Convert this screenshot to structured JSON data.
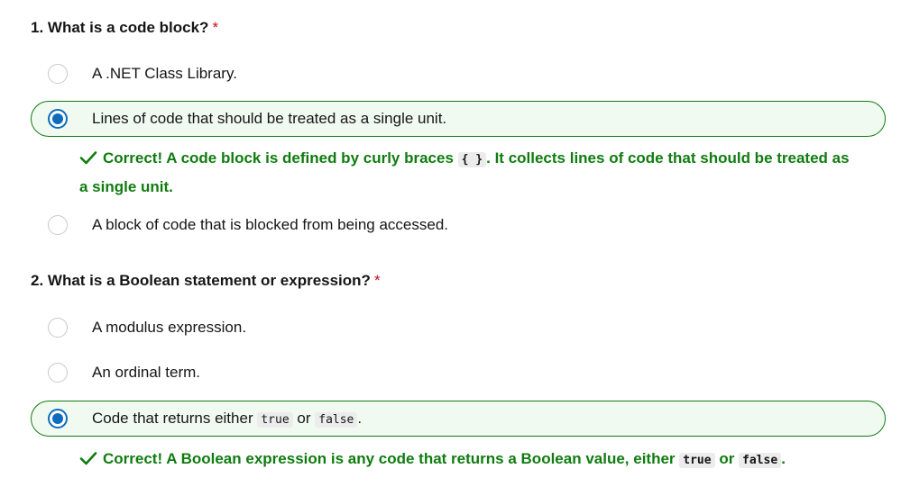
{
  "questions": [
    {
      "title": "1. What is a code block?",
      "required_mark": "*",
      "options": [
        {
          "label": "A .NET Class Library."
        },
        {
          "label": "Lines of code that should be treated as a single unit."
        },
        {
          "label": "A block of code that is blocked from being accessed."
        }
      ],
      "selected_option": 1,
      "feedback": {
        "prefix": "Correct! A code block is defined by curly braces",
        "code": "{ }",
        "suffix": ". It collects lines of code that should be treated as a single unit."
      }
    },
    {
      "title": "2. What is a Boolean statement or expression?",
      "required_mark": "*",
      "options": [
        {
          "label": "A modulus expression."
        },
        {
          "label": "An ordinal term."
        },
        {
          "label_prefix": "Code that returns either",
          "code1": "true",
          "label_mid": "or",
          "code2": "false",
          "label_suffix": "."
        }
      ],
      "selected_option": 2,
      "feedback": {
        "prefix": "Correct! A Boolean expression is any code that returns a Boolean value, either",
        "code1": "true",
        "mid": "or",
        "code2": "false",
        "suffix": "."
      }
    }
  ],
  "icons": {
    "check": "checkmark-icon"
  },
  "colors": {
    "correct_green": "#107c10",
    "selected_bg": "#f1faf1",
    "radio_blue": "#0f6cbd",
    "required_red": "#c50f1f"
  }
}
